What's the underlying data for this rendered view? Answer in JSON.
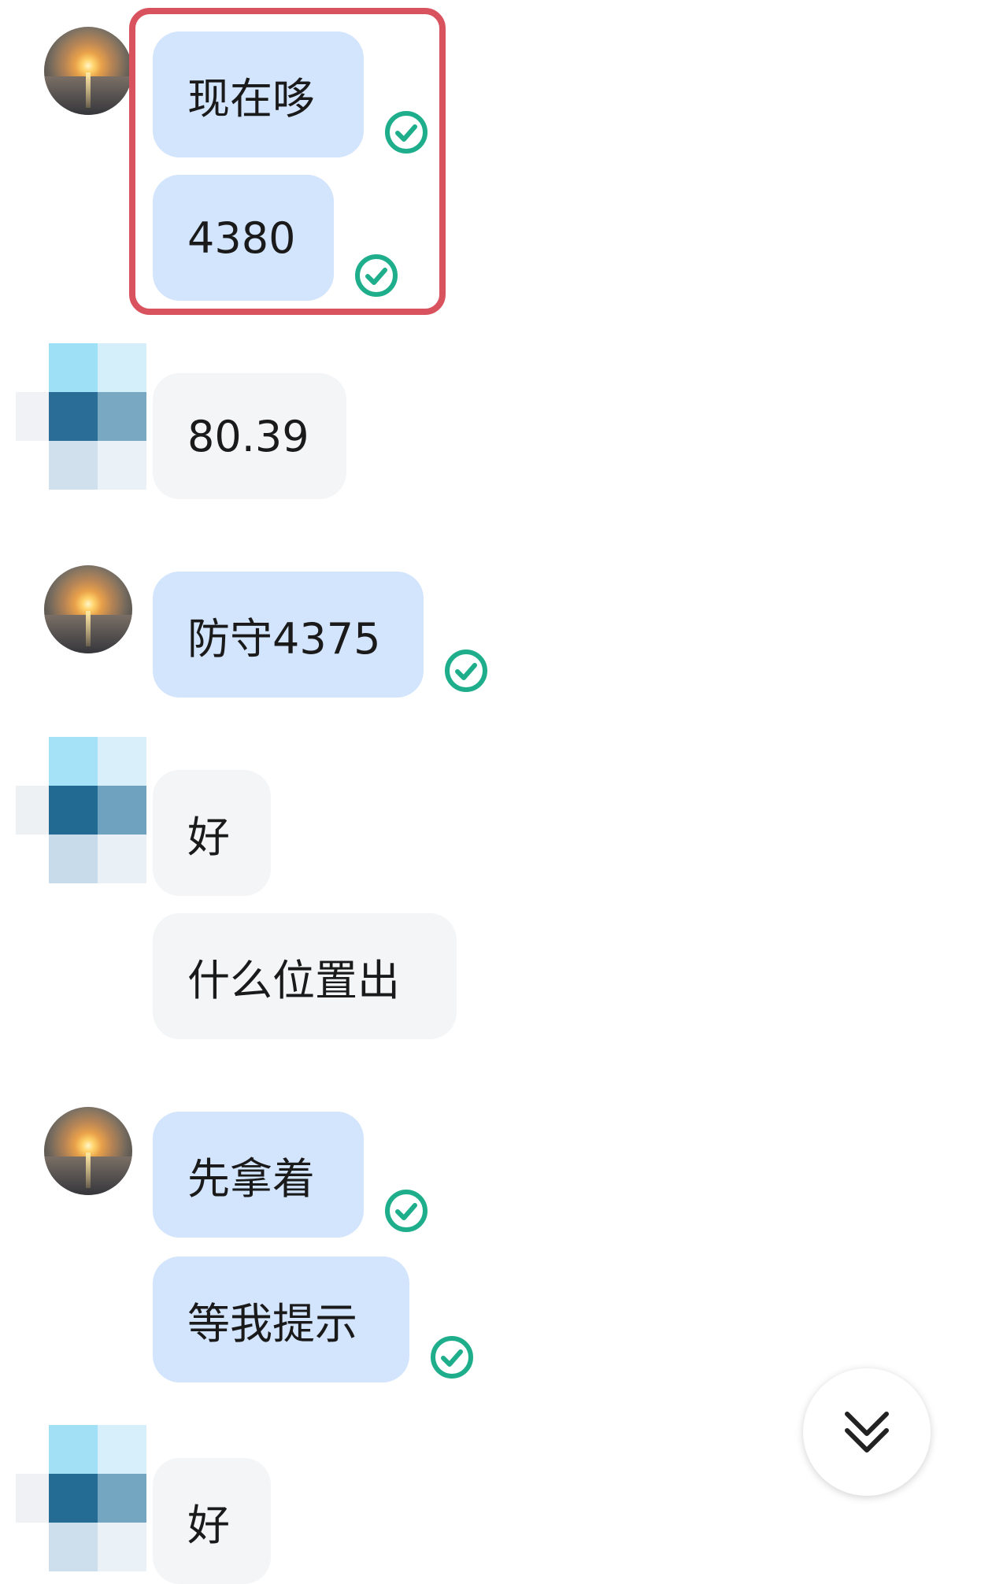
{
  "app": {
    "accent_color": "#1fae8c",
    "highlight_color": "#d9535f",
    "outgoing_bubble_color": "#d3e4fd",
    "incoming_bubble_color": "#f4f5f7"
  },
  "messages": [
    {
      "sender": "self",
      "text": "现在哆",
      "status": "read-check-icon"
    },
    {
      "sender": "self",
      "text": "4380",
      "status": "read-check-icon"
    },
    {
      "sender": "other",
      "text": "80.39"
    },
    {
      "sender": "self",
      "text": "防守4375",
      "status": "read-check-icon"
    },
    {
      "sender": "other",
      "text": "好"
    },
    {
      "sender": "other",
      "text": "什么位置出"
    },
    {
      "sender": "self",
      "text": "先拿着",
      "status": "read-check-icon"
    },
    {
      "sender": "self",
      "text": "等我提示",
      "status": "read-check-icon"
    },
    {
      "sender": "other",
      "text": "好"
    }
  ],
  "scroll_button": {
    "icon": "double-chevron-down-icon"
  }
}
